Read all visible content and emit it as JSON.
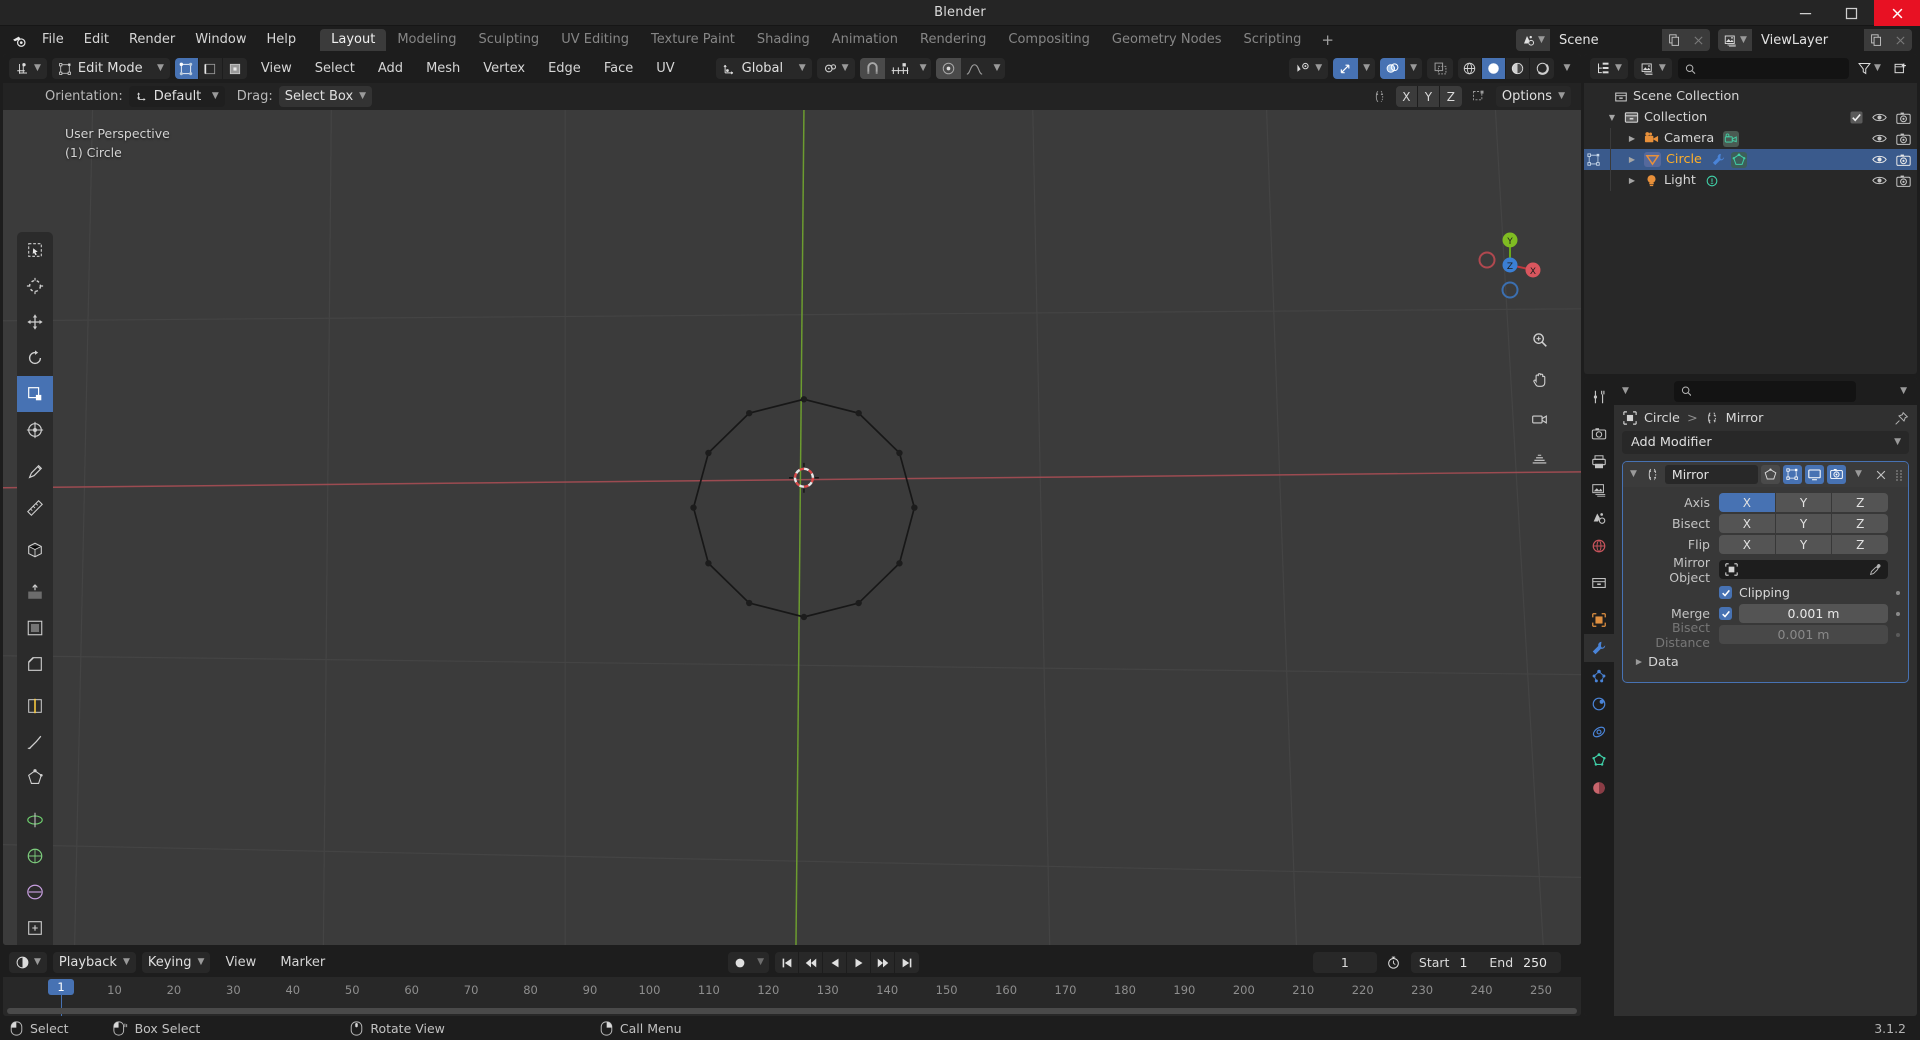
{
  "window": {
    "title": "Blender",
    "controls": [
      "minimize",
      "maximize",
      "close"
    ]
  },
  "topbar": {
    "logo_icon": "blender-logo-icon",
    "menus": [
      "File",
      "Edit",
      "Render",
      "Window",
      "Help"
    ],
    "workspaces": [
      "Layout",
      "Modeling",
      "Sculpting",
      "UV Editing",
      "Texture Paint",
      "Shading",
      "Animation",
      "Rendering",
      "Compositing",
      "Geometry Nodes",
      "Scripting"
    ],
    "active_workspace": "Layout",
    "add_workspace_label": "+",
    "scene": {
      "icon": "scene-icon",
      "name": "Scene",
      "new_icon": "copy-icon",
      "unlink_icon": "close-icon"
    },
    "viewlayer": {
      "icon": "viewlayer-icon",
      "name": "ViewLayer",
      "new_icon": "copy-icon",
      "unlink_icon": "close-icon"
    }
  },
  "viewport": {
    "header": {
      "editor_type_icon": "editor-type-icon",
      "mode": "Edit Mode",
      "select_modes": [
        "vertex-select",
        "edge-select",
        "face-select"
      ],
      "active_select_mode": 0,
      "menus": [
        "View",
        "Select",
        "Add",
        "Mesh",
        "Vertex",
        "Edge",
        "Face",
        "UV"
      ],
      "transform_orientation": "Global",
      "snap_icon": "magnet-icon",
      "snap_target_icon": "snap-increment-icon",
      "proportional_icon": "proportional-edit-icon",
      "falloff_icon": "smooth-falloff-icon",
      "visibility_icon": "visibility-icon",
      "gizmo_icon": "gizmo-icon",
      "overlays_icon": "overlays-icon",
      "xray_icon": "xray-icon",
      "shading_modes": [
        "wireframe",
        "solid",
        "material",
        "rendered"
      ],
      "active_shading": 1
    },
    "subheader": {
      "orientation_label": "Orientation:",
      "orientation_value": "Default",
      "drag_label": "Drag:",
      "drag_value": "Select Box",
      "mirror_icon": "mirror-icon",
      "axes": [
        "X",
        "Y",
        "Z"
      ],
      "snap_proj_icon": "snap-project-icon",
      "options_label": "Options"
    },
    "overlay_lines": [
      "User Perspective",
      "(1) Circle"
    ],
    "tools": [
      "tweak-select-tool",
      "cursor-tool",
      "move-tool",
      "rotate-tool",
      "scale-tool",
      "transform-tool",
      "annotate-tool",
      "measure-tool",
      "add-cube-tool",
      "extrude-region-tool",
      "inset-faces-tool",
      "bevel-tool",
      "loop-cut-tool",
      "knife-tool",
      "poly-build-tool",
      "spin-tool",
      "smooth-tool",
      "edge-slide-tool",
      "shrink-fatten-tool",
      "shear-tool",
      "rip-region-tool"
    ],
    "active_tool_index": 4,
    "nav_icons": [
      "zoom-icon",
      "pan-hand-icon",
      "camera-view-icon",
      "toggle-ortho-icon"
    ],
    "gizmo_axes": {
      "x": "X",
      "y": "Y",
      "z": "Z"
    },
    "object_name": "Circle",
    "mesh_vertex_count": 12
  },
  "timeline": {
    "editor_icon": "timeline-editor-icon",
    "menus": [
      "Playback",
      "Keying",
      "View",
      "Marker"
    ],
    "record_icon": "record-icon",
    "transport": [
      "jump-to-start",
      "jump-to-prev-keyframe",
      "play-reverse",
      "play",
      "jump-to-next-keyframe",
      "jump-to-end"
    ],
    "current_frame": "1",
    "auto_key_icon": "stopwatch-icon",
    "start_label": "Start",
    "start_value": "1",
    "end_label": "End",
    "end_value": "250",
    "ticks": [
      "10",
      "20",
      "30",
      "40",
      "50",
      "60",
      "70",
      "80",
      "90",
      "100",
      "110",
      "120",
      "130",
      "140",
      "150",
      "160",
      "170",
      "180",
      "190",
      "200",
      "210",
      "220",
      "230",
      "240",
      "250"
    ],
    "playhead_frame": "1"
  },
  "outliner": {
    "display_mode_icon": "outliner-display-mode-icon",
    "filter_id_icon": "filter-id-icon",
    "search_placeholder": "",
    "search_value": "",
    "filter_icon": "funnel-icon",
    "new_collection_icon": "new-collection-icon",
    "rows": [
      {
        "label": "Scene Collection",
        "icon": "collection-icon",
        "indent": 0,
        "expandable": false,
        "selected": false,
        "checkbox": false,
        "active": false
      },
      {
        "label": "Collection",
        "icon": "collection-icon",
        "indent": 1,
        "expandable": true,
        "expanded": true,
        "selected": false,
        "checkbox": true,
        "active": false
      },
      {
        "label": "Camera",
        "icon": "camera-object-icon",
        "data_icon": "camera-data-icon",
        "indent": 2,
        "expandable": true,
        "expanded": false,
        "selected": false,
        "checkbox": false,
        "active": false
      },
      {
        "label": "Circle",
        "icon": "mesh-object-icon",
        "data_icon": "mesh-data-icon",
        "extra_icon": "modifier-wrench-icon",
        "indent": 2,
        "expandable": true,
        "expanded": false,
        "selected": true,
        "checkbox": false,
        "active": true
      },
      {
        "label": "Light",
        "icon": "light-object-icon",
        "data_icon": "light-data-icon",
        "indent": 2,
        "expandable": true,
        "expanded": false,
        "selected": false,
        "checkbox": false,
        "active": false
      }
    ]
  },
  "properties": {
    "search_placeholder": "",
    "search_value": "",
    "tabs": [
      "tool-tab",
      "render-tab",
      "output-tab",
      "viewlayer-tab",
      "scene-tab",
      "world-tab",
      "collection-tab",
      "object-tab",
      "modifier-tab",
      "particles-tab",
      "physics-tab",
      "constraints-tab",
      "data-tab",
      "material-tab"
    ],
    "active_tab": "modifier-tab",
    "breadcrumb": {
      "object_icon": "object-icon",
      "object": "Circle",
      "sep": ">",
      "modifier_icon": "modifier-icon",
      "modifier": "Mirror"
    },
    "pin_icon": "pin-icon",
    "add_modifier_label": "Add Modifier",
    "modifier": {
      "expand_icon": "chevron-down-icon",
      "type_icon": "mirror-modifier-icon",
      "name": "Mirror",
      "toggles": [
        {
          "icon": "edit-mode-display-icon",
          "on": false
        },
        {
          "icon": "on-cage-icon",
          "on": true
        },
        {
          "icon": "realtime-display-icon",
          "on": true
        },
        {
          "icon": "render-display-icon",
          "on": true
        }
      ],
      "extras_icon": "chevron-down-icon",
      "close_icon": "close-icon",
      "drag_icon": "drag-dots-icon",
      "axis_label": "Axis",
      "axis_buttons": [
        "X",
        "Y",
        "Z"
      ],
      "axis_active": [
        "X"
      ],
      "bisect_label": "Bisect",
      "bisect_buttons": [
        "X",
        "Y",
        "Z"
      ],
      "bisect_active": [],
      "flip_label": "Flip",
      "flip_buttons": [
        "X",
        "Y",
        "Z"
      ],
      "flip_active": [],
      "mirror_object_label": "Mirror Object",
      "mirror_object_value": "",
      "mirror_object_icon": "object-icon",
      "eyedropper_icon": "eyedropper-icon",
      "clipping_label": "Clipping",
      "clipping_checked": true,
      "merge_label": "Merge",
      "merge_checked": true,
      "merge_value": "0.001 m",
      "bisect_distance_label": "Bisect Distance",
      "bisect_distance_value": "0.001 m",
      "data_label": "Data"
    }
  },
  "statusbar": {
    "items": [
      {
        "icon": "mouse-left-icon",
        "label": "Select"
      },
      {
        "icon": "mouse-left-drag-icon",
        "label": "Box Select"
      },
      {
        "icon": "mouse-middle-icon",
        "label": "Rotate View"
      },
      {
        "icon": "mouse-right-icon",
        "label": "Call Menu"
      }
    ],
    "version": "3.1.2"
  },
  "colors": {
    "accent_blue": "#4772b3",
    "window_bg": "#1d1d1d",
    "editor_bg": "#303030",
    "viewport_bg": "#3b3b3b",
    "panel_bg": "#282828",
    "active_text": "#ffaf29",
    "axis_x_red": "#c0393f",
    "axis_y_green": "#6aa81a",
    "close_red": "#e81123"
  }
}
